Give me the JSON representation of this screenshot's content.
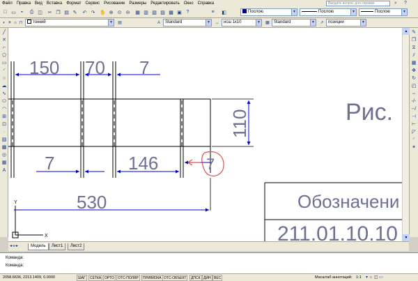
{
  "menu": [
    "Файл",
    "Правка",
    "Вид",
    "Вставка",
    "Формат",
    "Сервис",
    "Рисование",
    "Размеры",
    "Редактировать",
    "Окно",
    "Справка"
  ],
  "help_placeholder": "Введите вопрос для справки",
  "toolbar1": {
    "layer_color_label": "Послою",
    "linetype_label": "Послою",
    "lineweight_label": "Послою"
  },
  "toolbar2": {
    "layer_name": "тонкий",
    "text_style": "Standard",
    "dim_style": "нсш 1к10",
    "table_style": "Standard",
    "multileader_style": "позиции"
  },
  "drawing": {
    "dims_top": [
      "150",
      "70",
      "7"
    ],
    "dim_vertical": "110",
    "dims_middle": [
      "7",
      "146",
      "7"
    ],
    "dim_bottom": "530",
    "title_text": "Рис.",
    "designation_label": "Обозначени",
    "designation_value": "211.01.10.10",
    "ucs_y": "Y",
    "ucs_x": "X"
  },
  "tabs": [
    "Модель",
    "Лист1",
    "Лист2"
  ],
  "command_lines": [
    "Команда:",
    "Команда:"
  ],
  "status": {
    "coords": "2058.6636, 2213.1409, 0.0000",
    "toggles": [
      "ШАГ",
      "СЕТКА",
      "ОРТО",
      "ОТС-ПОЛЯР",
      "ПРИВЯЗКА",
      "ОТС-ОБЪЕКТ",
      "ДПСК",
      "ДИН",
      "ВЕС"
    ],
    "scale_label": "Масштаб аннотаций:",
    "scale_value": "1:1"
  },
  "colors": {
    "dimension": "#0000cc",
    "text": "#6e7091",
    "highlight": "#d9534f",
    "geometry": "#000000"
  }
}
